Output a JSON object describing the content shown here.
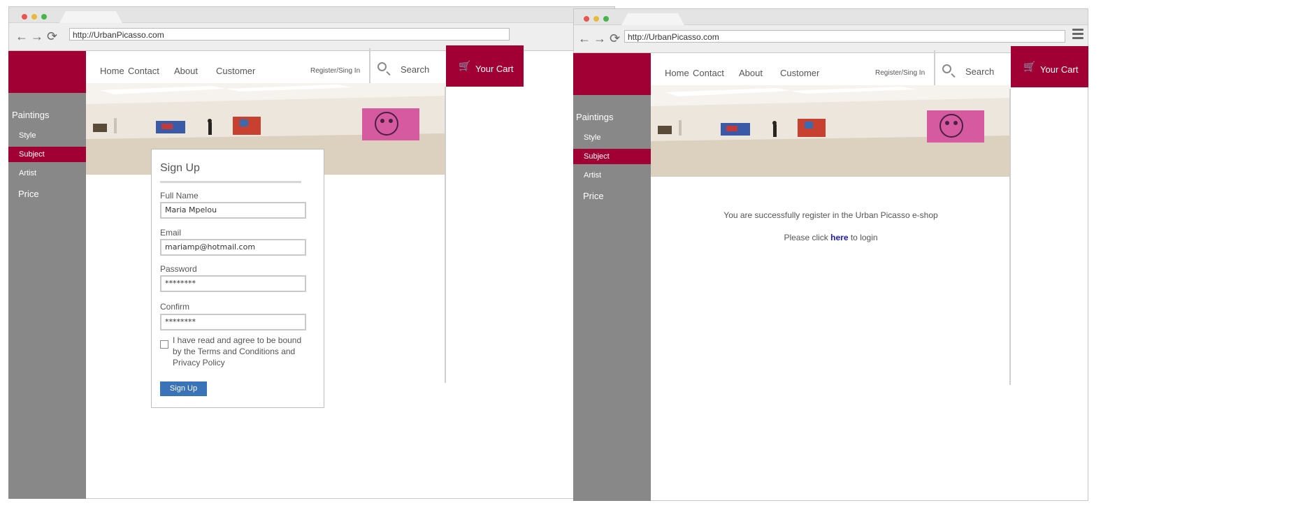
{
  "browser": {
    "url": "http://UrbanPicasso.com"
  },
  "nav": {
    "home": "Home",
    "contact": "Contact",
    "about": "About",
    "customer": "Customer",
    "register": "Register/Sing In",
    "search": "Search",
    "cart": "Your Cart"
  },
  "sidebar": {
    "heading": "Paintings",
    "items": [
      "Style",
      "Subject",
      "Artist"
    ],
    "price": "Price",
    "active": "Subject"
  },
  "signup": {
    "title": "Sign Up",
    "fullname_label": "Full Name",
    "fullname_value": "Maria Mpelou",
    "email_label": "Email",
    "email_value": "mariamp@hotmail.com",
    "password_label": "Password",
    "password_value": "********",
    "confirm_label": "Confirm",
    "confirm_value": "********",
    "terms_text": "I have read and agree to be bound by the Terms and Conditions and Privacy Policy",
    "button": "Sign Up"
  },
  "success": {
    "line1": "You are successfully register in the Urban Picasso e-shop",
    "line2_pre": "Please click ",
    "line2_link": "here",
    "line2_post": " to login"
  },
  "colors": {
    "brand": "#a00034",
    "sidebar": "#888888",
    "button": "#3a73b8",
    "link": "#1a1acc"
  }
}
